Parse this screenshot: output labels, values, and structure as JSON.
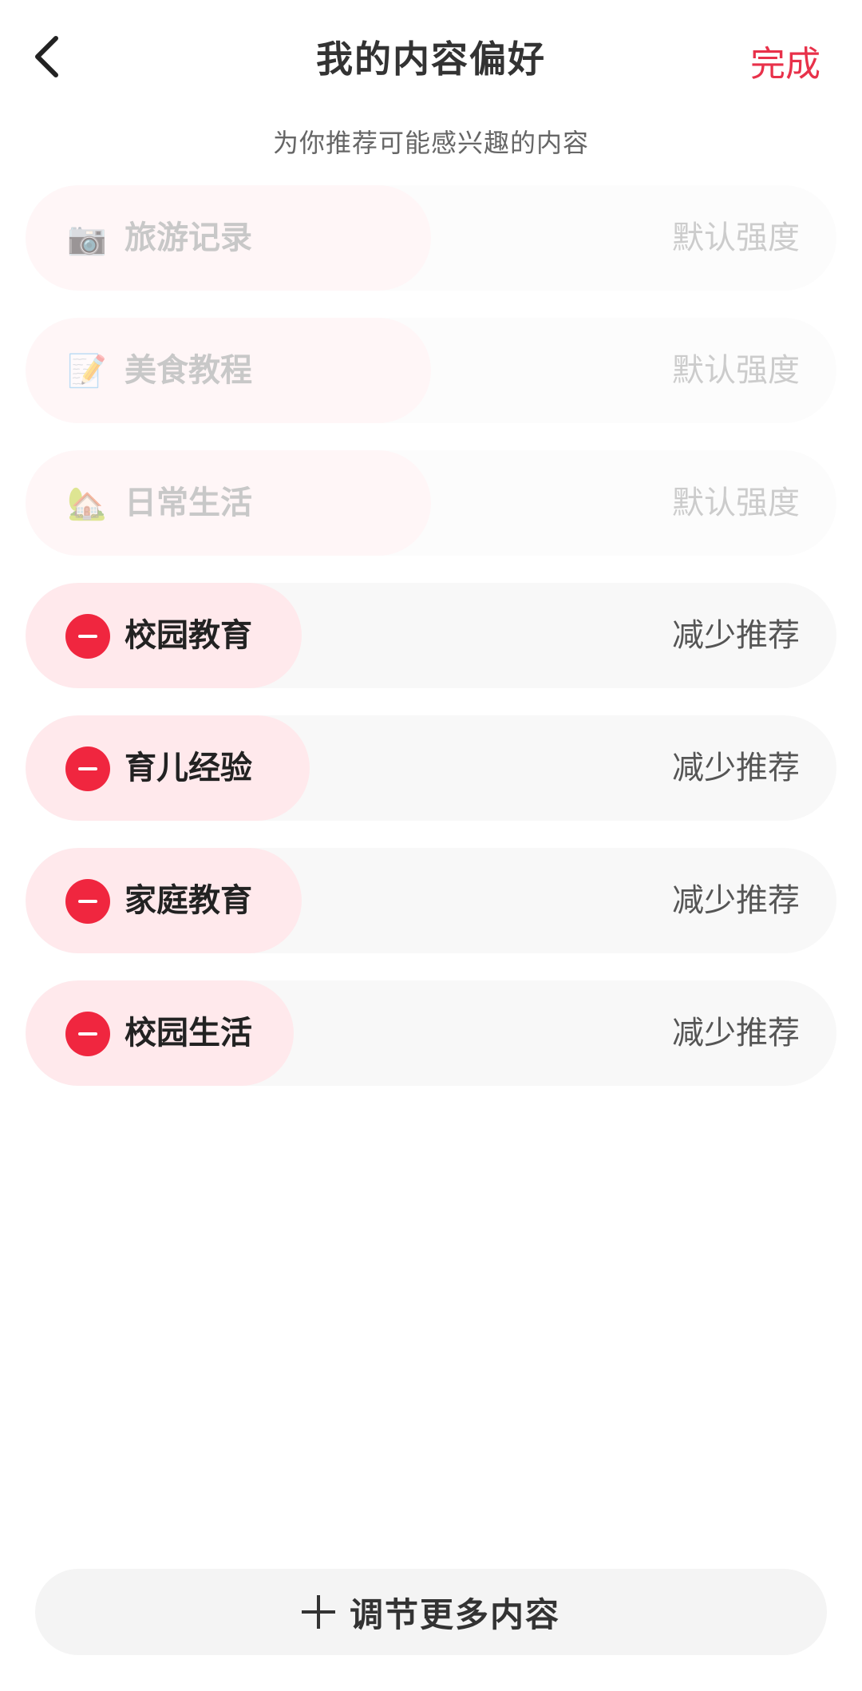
{
  "header": {
    "title": "我的内容偏好",
    "done_label": "完成",
    "subtitle": "为你推荐可能感兴趣的内容"
  },
  "preferences": [
    {
      "icon": "camera-icon",
      "glyph": "📷",
      "label": "旅游记录",
      "status": "默认强度",
      "state": "default"
    },
    {
      "icon": "memo-icon",
      "glyph": "📝",
      "label": "美食教程",
      "status": "默认强度",
      "state": "default"
    },
    {
      "icon": "house-icon",
      "glyph": "🏡",
      "label": "日常生活",
      "status": "默认强度",
      "state": "default"
    },
    {
      "icon": "minus-icon",
      "label": "校园教育",
      "status": "减少推荐",
      "state": "reduced"
    },
    {
      "icon": "minus-icon",
      "label": "育儿经验",
      "status": "减少推荐",
      "state": "reduced"
    },
    {
      "icon": "minus-icon",
      "label": "家庭教育",
      "status": "减少推荐",
      "state": "reduced"
    },
    {
      "icon": "minus-icon",
      "label": "校园生活",
      "status": "减少推荐",
      "state": "reduced"
    }
  ],
  "footer": {
    "add_more_label": "调节更多内容",
    "icon": "plus-icon"
  },
  "colors": {
    "accent": "#e8314a",
    "minus": "#f0263f",
    "reduced_pill": "#ffe9ec"
  }
}
